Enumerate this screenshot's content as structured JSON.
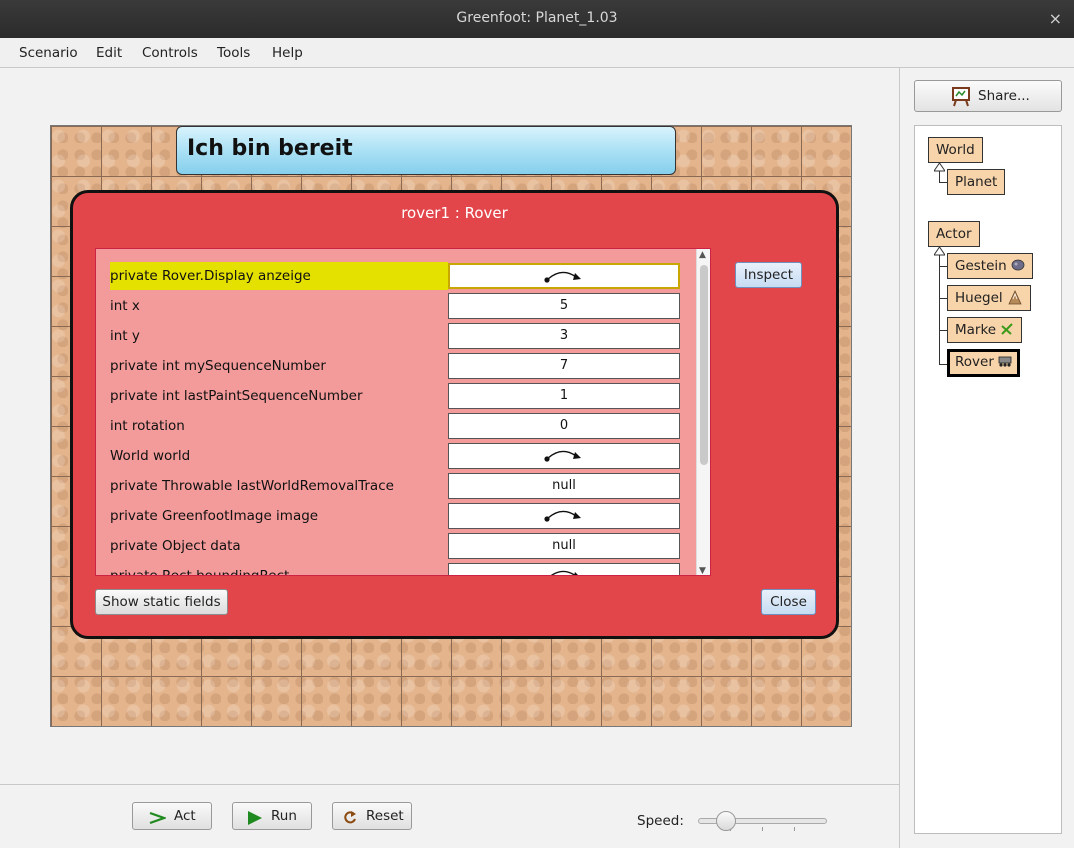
{
  "window": {
    "title": "Greenfoot: Planet_1.03",
    "close_icon": "×"
  },
  "menu": [
    "Scenario",
    "Edit",
    "Controls",
    "Tools",
    "Help"
  ],
  "world": {
    "banner_text": "Ich bin bereit"
  },
  "inspector": {
    "title": "rover1 : Rover",
    "fields": [
      {
        "name": "private Rover.Display anzeige",
        "value": "",
        "is_reference": true,
        "selected": true
      },
      {
        "name": "int x",
        "value": "5"
      },
      {
        "name": "int y",
        "value": "3"
      },
      {
        "name": "private int mySequenceNumber",
        "value": "7"
      },
      {
        "name": "private int lastPaintSequenceNumber",
        "value": "1"
      },
      {
        "name": "int rotation",
        "value": "0"
      },
      {
        "name": "World world",
        "value": "",
        "is_reference": true
      },
      {
        "name": "private Throwable lastWorldRemovalTrace",
        "value": "null"
      },
      {
        "name": "private GreenfootImage image",
        "value": "",
        "is_reference": true
      },
      {
        "name": "private Object data",
        "value": "null"
      },
      {
        "name": "private Rect boundingRect",
        "value": "",
        "is_reference": true
      }
    ],
    "inspect_label": "Inspect",
    "show_static_label": "Show static fields",
    "close_label": "Close"
  },
  "share": {
    "label": "Share...",
    "icon": "easel-icon"
  },
  "class_tree": {
    "world_root": "World",
    "world_children": [
      "Planet"
    ],
    "actor_root": "Actor",
    "actor_children": [
      {
        "label": "Gestein",
        "icon": "rock-icon"
      },
      {
        "label": "Huegel",
        "icon": "hill-icon"
      },
      {
        "label": "Marke",
        "icon": "marker-icon"
      },
      {
        "label": "Rover",
        "icon": "rover-icon",
        "selected": true
      }
    ]
  },
  "controls": {
    "act_label": "Act",
    "run_label": "Run",
    "reset_label": "Reset",
    "speed_label": "Speed:",
    "speed_value_fraction": 0.2
  },
  "colors": {
    "inspector_bg": "#e3464a",
    "fields_bg": "#f39b9a",
    "selected_field": "#e4e000",
    "class_box": "#f7d4aa"
  }
}
